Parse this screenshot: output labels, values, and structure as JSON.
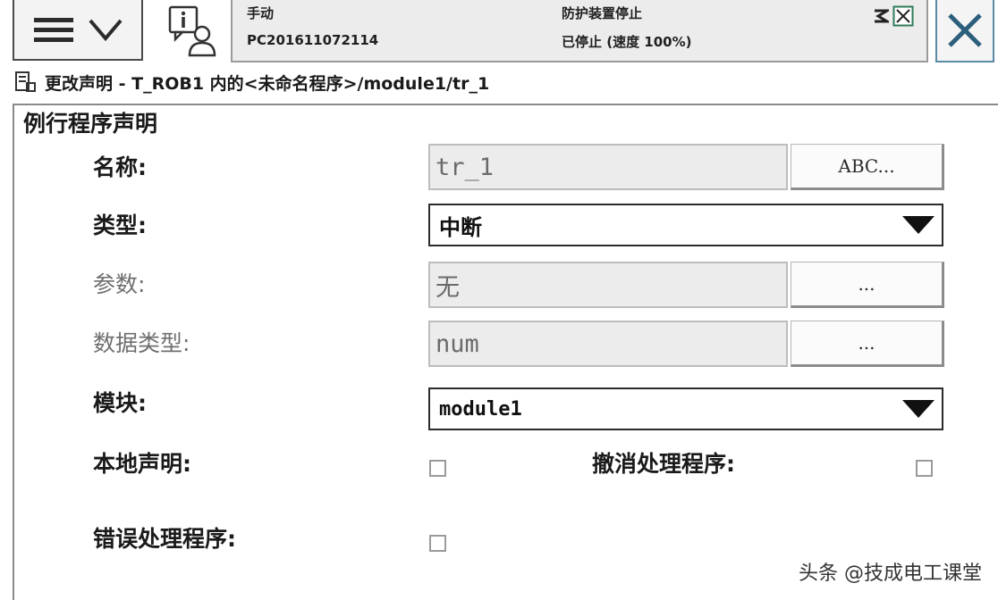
{
  "header": {
    "mode": "手动",
    "system_name": "PC201611072114",
    "safety_status": "防护装置停止",
    "run_status": "已停止 (速度 100%)"
  },
  "title": "更改声明 - T_ROB1 内的<未命名程序>/module1/tr_1",
  "section_title": "例行程序声明",
  "form": {
    "name": {
      "label": "名称:",
      "value": "tr_1",
      "button": "ABC..."
    },
    "type": {
      "label": "类型:",
      "value": "中断"
    },
    "params": {
      "label": "参数:",
      "value": "无",
      "button": "..."
    },
    "datatype": {
      "label": "数据类型:",
      "value": "num",
      "button": "..."
    },
    "module": {
      "label": "模块:",
      "value": "module1"
    },
    "local": {
      "label": "本地声明:",
      "checked": false
    },
    "undo": {
      "label": "撤消处理程序:",
      "checked": false
    },
    "error": {
      "label": "错误处理程序:",
      "checked": false
    }
  },
  "watermark": "头条 @技成电工课堂",
  "icons": {
    "menu": "hamburger-icon",
    "expand": "chevron-down-icon",
    "status": "info-person-icon",
    "motor": "motor-status-icon",
    "close": "close-icon"
  }
}
